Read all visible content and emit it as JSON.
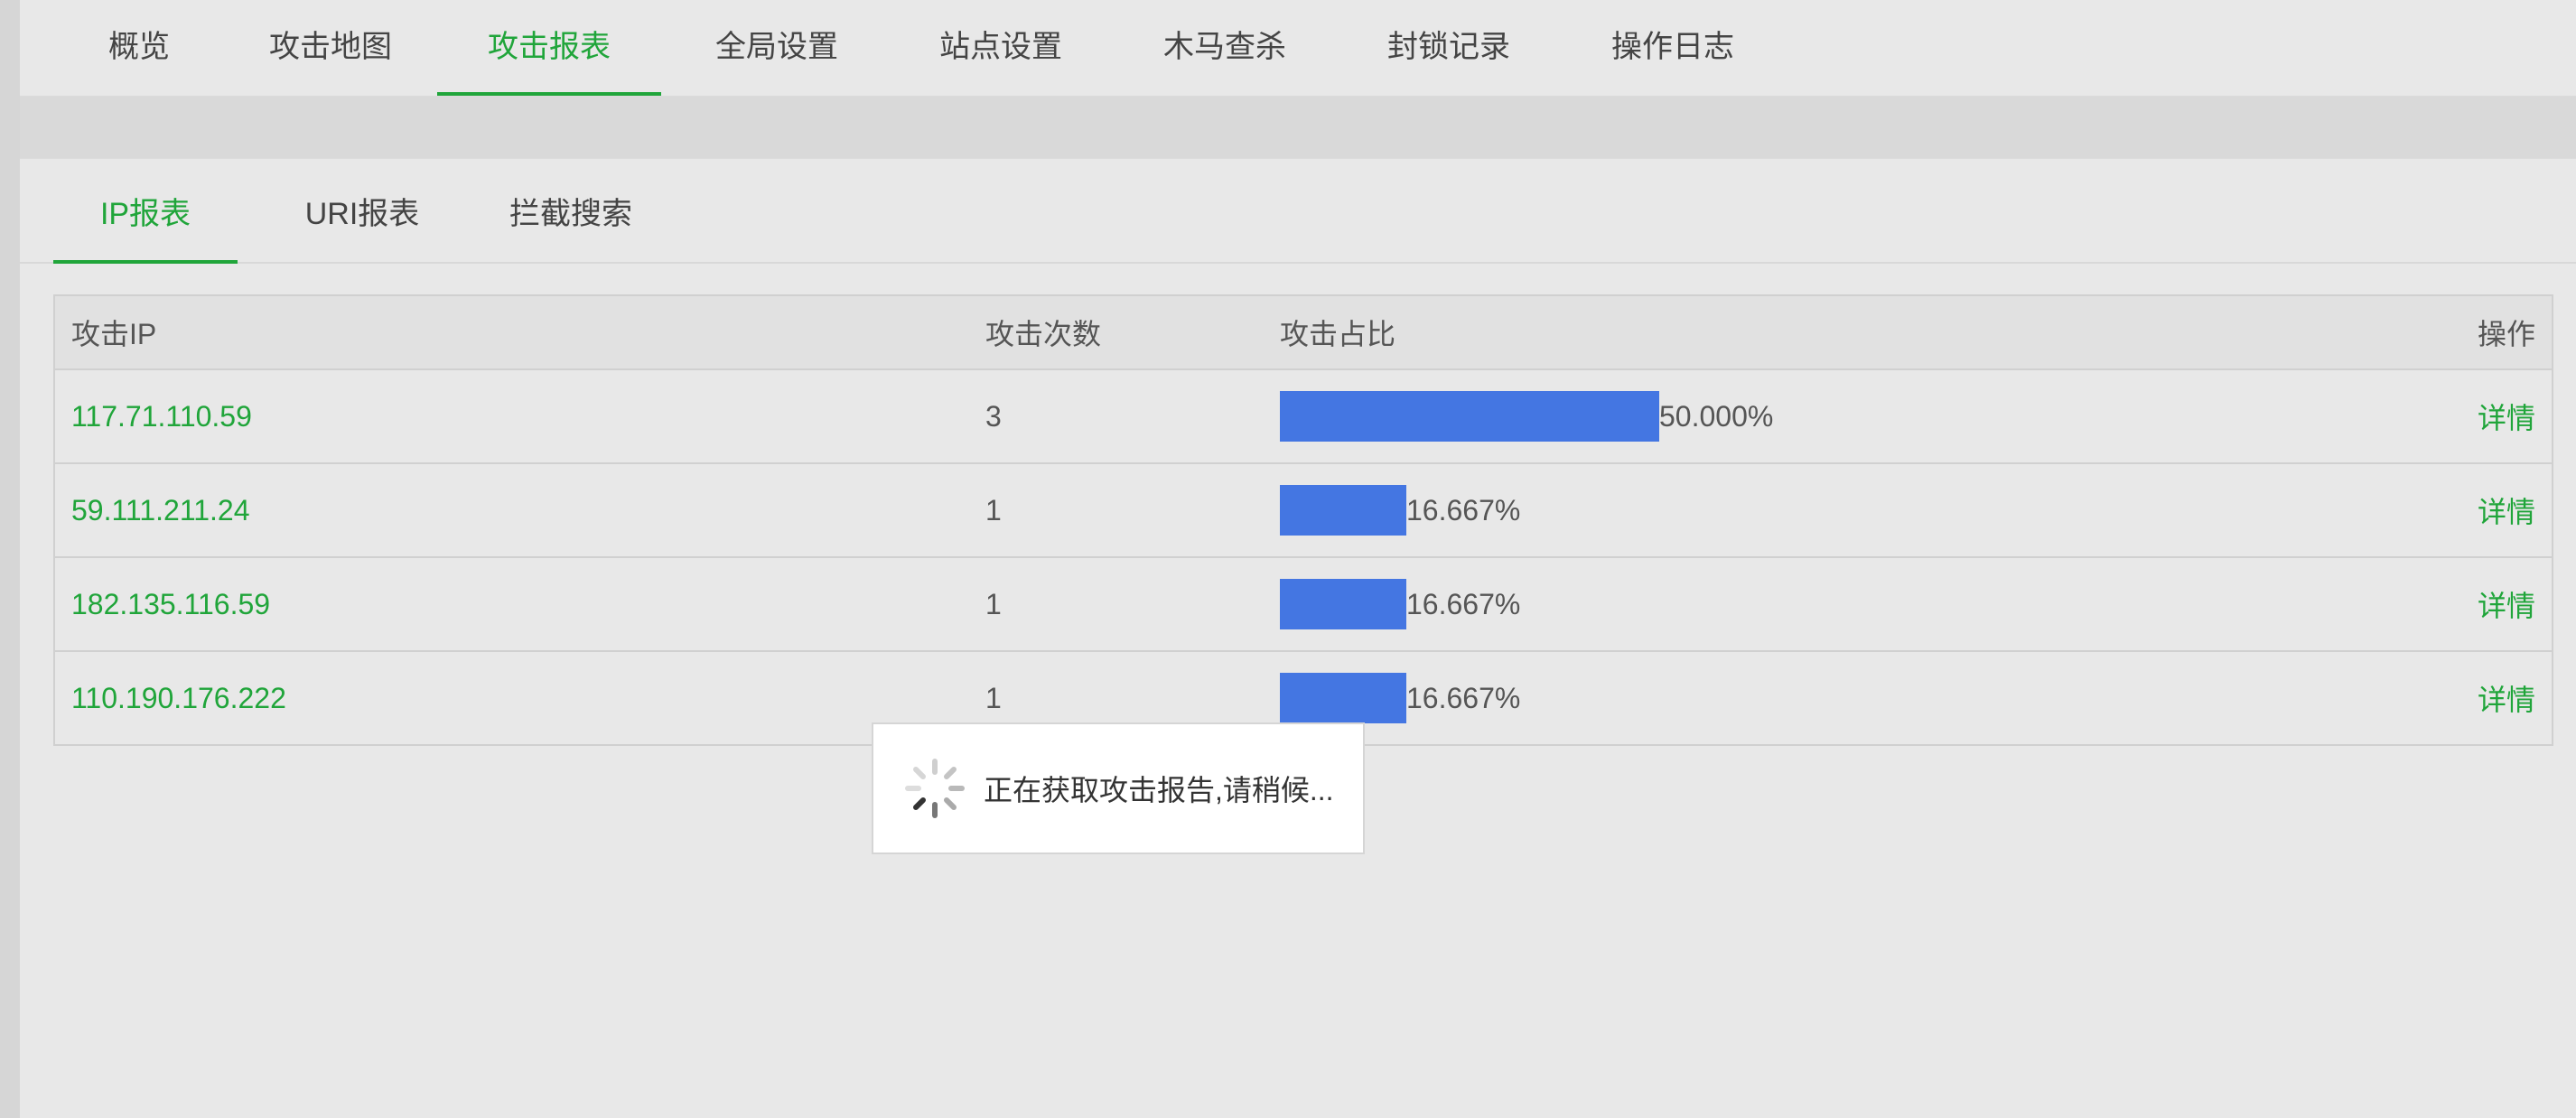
{
  "topnav": {
    "tabs": [
      {
        "label": "概览"
      },
      {
        "label": "攻击地图"
      },
      {
        "label": "攻击报表"
      },
      {
        "label": "全局设置"
      },
      {
        "label": "站点设置"
      },
      {
        "label": "木马查杀"
      },
      {
        "label": "封锁记录"
      },
      {
        "label": "操作日志"
      }
    ],
    "active_index": 2
  },
  "subtabs": {
    "tabs": [
      {
        "label": "IP报表"
      },
      {
        "label": "URI报表"
      },
      {
        "label": "拦截搜索"
      }
    ],
    "active_index": 0
  },
  "table": {
    "headers": {
      "ip": "攻击IP",
      "count": "攻击次数",
      "ratio": "攻击占比",
      "op": "操作"
    },
    "rows": [
      {
        "ip": "117.71.110.59",
        "count": "3",
        "ratio_value": 0.5,
        "ratio_label": "50.000%",
        "op": "详情"
      },
      {
        "ip": "59.111.211.24",
        "count": "1",
        "ratio_value": 0.16667,
        "ratio_label": "16.667%",
        "op": "详情"
      },
      {
        "ip": "182.135.116.59",
        "count": "1",
        "ratio_value": 0.16667,
        "ratio_label": "16.667%",
        "op": "详情"
      },
      {
        "ip": "110.190.176.222",
        "count": "1",
        "ratio_value": 0.16667,
        "ratio_label": "16.667%",
        "op": "详情"
      }
    ]
  },
  "loading": {
    "text": "正在获取攻击报告,请稍候...",
    "icon": "spinner-icon"
  },
  "colors": {
    "accent": "#20a53a",
    "bar": "#4476e2"
  }
}
